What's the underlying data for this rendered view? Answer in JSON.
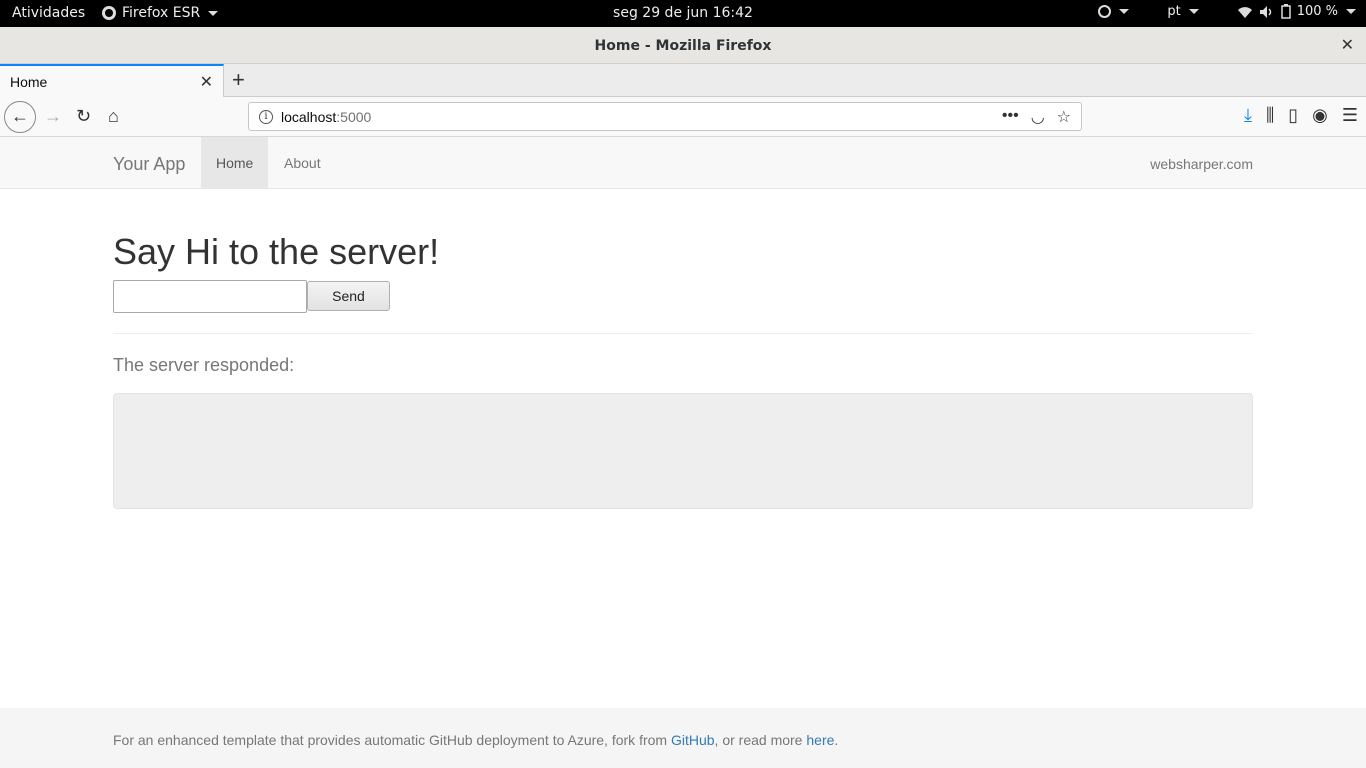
{
  "system_bar": {
    "activities": "Atividades",
    "app_name": "Firefox ESR",
    "clock": "seg 29 de jun  16:42",
    "language": "pt",
    "battery": "100 %"
  },
  "window": {
    "title": "Home - Mozilla Firefox"
  },
  "tabs": [
    {
      "label": "Home",
      "active": true
    }
  ],
  "urlbar": {
    "host": "localhost",
    "port": ":5000"
  },
  "site": {
    "brand": "Your App",
    "nav": [
      {
        "label": "Home",
        "active": true
      },
      {
        "label": "About",
        "active": false
      }
    ],
    "nav_right": "websharper.com",
    "heading": "Say Hi to the server!",
    "input_value": "",
    "send_label": "Send",
    "response_label": "The server responded:",
    "response_value": "",
    "footer": {
      "prefix": "For an enhanced template that provides automatic GitHub deployment to Azure, fork from ",
      "link1": "GitHub",
      "middle": ", or read more ",
      "link2": "here",
      "suffix": "."
    }
  },
  "colors": {
    "link": "#337ab7",
    "accent_tab": "#0a84ff",
    "download_icon": "#0a84ff"
  }
}
